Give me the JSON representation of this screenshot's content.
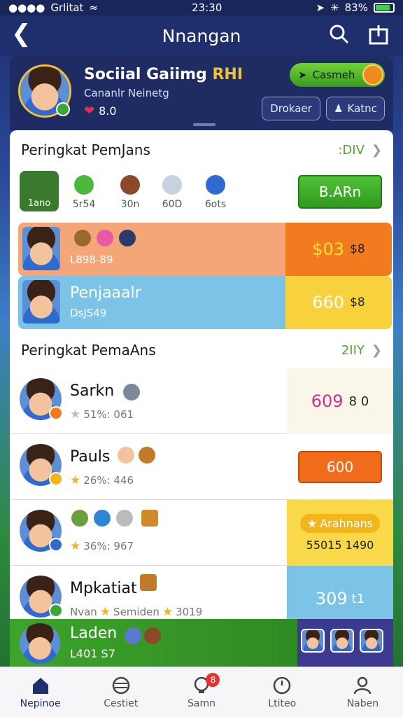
{
  "status": {
    "carrier": "Grlitat",
    "time": "23:30",
    "battery": "83%",
    "battery_fraction": 0.83
  },
  "nav": {
    "title": "Nnangan"
  },
  "profile": {
    "name_a": "Sociial Gaiimg",
    "name_b": "RHI",
    "subtitle": "Cananlr Neinetg",
    "likes": "8.0",
    "green_button": "Casmeh",
    "btn_a": "Drokaer",
    "btn_b": "Katnc"
  },
  "section1": {
    "title": "Peringkat PemJans",
    "more": ":DIV",
    "tile_label": "1ano",
    "minis": [
      "5r54",
      "30n",
      "60D",
      "6ots"
    ],
    "action_button": "B.ARn"
  },
  "highlight_rows": [
    {
      "label": "L898-89",
      "score": "$03",
      "score_small": "$8",
      "color": "#f5a679",
      "score_bg": "#f27a1f",
      "score_color": "#ffe23a"
    },
    {
      "name": "Penjaaalr",
      "label": "DsJS49",
      "score": "660",
      "score_small": "$8",
      "color": "#7cc3e8",
      "score_bg": "#f7d23c",
      "score_color": "#ffffff"
    }
  ],
  "section2": {
    "title": "Peringkat PemaAns",
    "more": "2IIY"
  },
  "rows": [
    {
      "name": "Sarkn",
      "stat": "51%: 061",
      "score": "609",
      "score_small": "8 0"
    },
    {
      "name": "Pauls",
      "stat": "26%: 446",
      "button": "600"
    },
    {
      "stat": "36%: 967",
      "badge": "Arahnans",
      "subtext": "55015 1490"
    },
    {
      "name": "Mpkatiat",
      "stat_a": "Nvan",
      "stat_b": "Semiden",
      "stat_c": "3019",
      "score": "309",
      "score_small": "t1"
    }
  ],
  "leader": {
    "name": "Laden",
    "sub": "L401 S7"
  },
  "tabs": [
    {
      "label": "Nepinoe",
      "icon": "home-icon"
    },
    {
      "label": "Cestiet",
      "icon": "ball-icon"
    },
    {
      "label": "Samn",
      "icon": "trophy-icon",
      "badge": "8"
    },
    {
      "label": "Ltiteo",
      "icon": "clock-icon"
    },
    {
      "label": "Naben",
      "icon": "user-icon"
    }
  ],
  "colors": {
    "nav": "#1f2f6e",
    "green": "#3a9a1c",
    "orange": "#f27a1f",
    "blue": "#7cc3e8",
    "yellow": "#f7d23c"
  }
}
